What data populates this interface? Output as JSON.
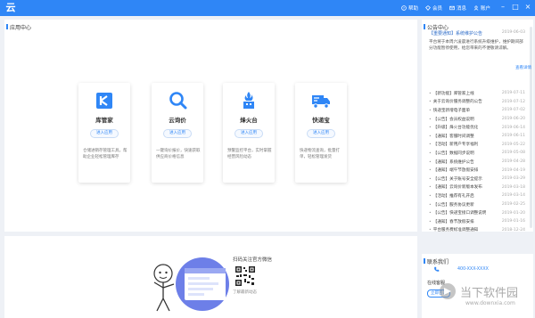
{
  "app": {
    "logo": "云"
  },
  "nav": [
    {
      "label": "帮助",
      "icon": "help-icon"
    },
    {
      "label": "会员",
      "icon": "member-icon"
    },
    {
      "label": "消息",
      "icon": "message-icon"
    },
    {
      "label": "账户",
      "icon": "user-icon"
    }
  ],
  "window": {
    "minimize": "–",
    "maximize": "□",
    "close": "×"
  },
  "main": {
    "title": "应用中心",
    "products": [
      {
        "name": "库管家",
        "button": "进入应用",
        "desc": "仓储进销存管理工具，帮助企业轻松管理库存",
        "icon": "warehouse-icon",
        "color": "#2f86f6"
      },
      {
        "name": "云询价",
        "button": "进入应用",
        "desc": "一键询价报价，快速获取供应商价格信息",
        "icon": "search-icon",
        "color": "#2f86f6"
      },
      {
        "name": "烽火台",
        "button": "进入应用",
        "desc": "预警监控平台，实时掌握经营风险动态",
        "icon": "beacon-icon",
        "color": "#2f86f6"
      },
      {
        "name": "快递宝",
        "button": "进入应用",
        "desc": "快递物流查询，批量打单，轻松管理发货",
        "icon": "truck-icon",
        "color": "#2f86f6"
      }
    ]
  },
  "banner": {
    "qr_title": "扫码关注官方微信",
    "qr_caption": "了解最新动态"
  },
  "announcements": {
    "title": "公告中心",
    "featured": {
      "title": "【重要通知】系统维护公告",
      "date": "2019-06-03",
      "body": "平台将于本周六凌晨进行系统升级维护，维护期间部分功能暂停使用，给您带来的不便敬请谅解。",
      "more": "查看详情"
    },
    "items": [
      {
        "title": "【新功能】库管家上线",
        "date": "2019-07-11"
      },
      {
        "title": "关于云询价服务调整的公告",
        "date": "2019-07-12"
      },
      {
        "title": "快递宝新增电子面单",
        "date": "2019-07-02"
      },
      {
        "title": "【公告】会员权益说明",
        "date": "2019-06-20"
      },
      {
        "title": "【升级】烽火台功能优化",
        "date": "2019-06-14"
      },
      {
        "title": "【通知】客服时间调整",
        "date": "2019-06-11"
      },
      {
        "title": "【活动】新用户专享福利",
        "date": "2019-05-22"
      },
      {
        "title": "【公告】数据同步说明",
        "date": "2019-05-08"
      },
      {
        "title": "【通知】系统维护公告",
        "date": "2019-04-28"
      },
      {
        "title": "【通知】端午节放假安排",
        "date": "2019-04-19"
      },
      {
        "title": "【公告】关于账号安全提示",
        "date": "2019-03-29"
      },
      {
        "title": "【通知】云询价新版本发布",
        "date": "2019-03-18"
      },
      {
        "title": "【活动】推荐有礼开启",
        "date": "2019-03-14"
      },
      {
        "title": "【公告】服务协议更新",
        "date": "2019-02-25"
      },
      {
        "title": "【公告】快递宝接口调整说明",
        "date": "2019-01-20"
      },
      {
        "title": "【通知】春节放假安排",
        "date": "2019-01-16"
      },
      {
        "title": "平台服务费标准调整通知",
        "date": "2018-12-24"
      }
    ]
  },
  "contact": {
    "title": "联系我们",
    "phone": "400-XXX-XXXX",
    "service_label": "在线客服",
    "service_btn": "立即咨询"
  },
  "watermark": {
    "text1": "当下软件园",
    "text2": "www.downxia.com"
  }
}
